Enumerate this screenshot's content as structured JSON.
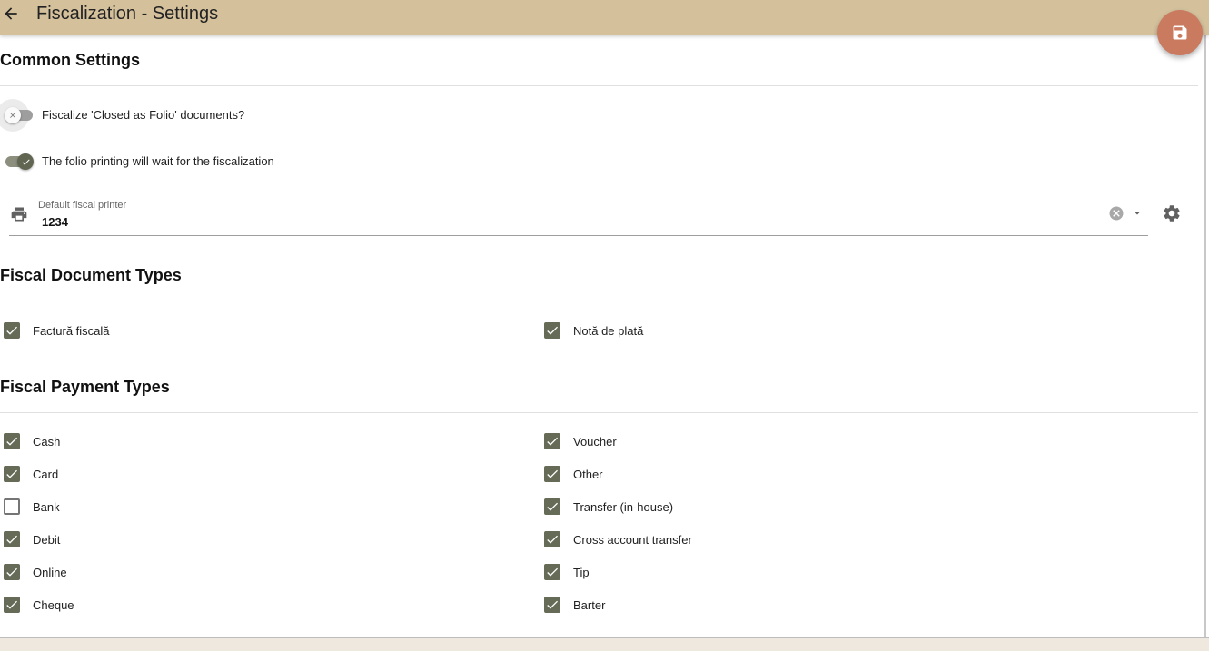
{
  "header": {
    "title": "Fiscalization - Settings"
  },
  "colors": {
    "app_bar": "#d4c19c",
    "fab": "#c97a5f",
    "accent": "#666b57"
  },
  "common": {
    "title": "Common Settings",
    "toggle_closed_folio": {
      "label": "Fiscalize 'Closed as Folio' documents?",
      "on": false
    },
    "toggle_folio_wait": {
      "label": "The folio printing will wait for the fiscalization",
      "on": true
    },
    "printer_field": {
      "label": "Default fiscal printer",
      "value": "1234"
    }
  },
  "document_types": {
    "title": "Fiscal Document Types",
    "items": [
      {
        "label": "Factură fiscală",
        "checked": true
      },
      {
        "label": "Notă de plată",
        "checked": true
      }
    ]
  },
  "payment_types": {
    "title": "Fiscal Payment Types",
    "items": [
      {
        "label": "Cash",
        "checked": true
      },
      {
        "label": "Card",
        "checked": true
      },
      {
        "label": "Bank",
        "checked": false
      },
      {
        "label": "Debit",
        "checked": true
      },
      {
        "label": "Online",
        "checked": true
      },
      {
        "label": "Cheque",
        "checked": true
      },
      {
        "label": "Voucher",
        "checked": true
      },
      {
        "label": "Other",
        "checked": true
      },
      {
        "label": "Transfer (in-house)",
        "checked": true
      },
      {
        "label": "Cross account transfer",
        "checked": true
      },
      {
        "label": "Tip",
        "checked": true
      },
      {
        "label": "Barter",
        "checked": true
      }
    ]
  }
}
